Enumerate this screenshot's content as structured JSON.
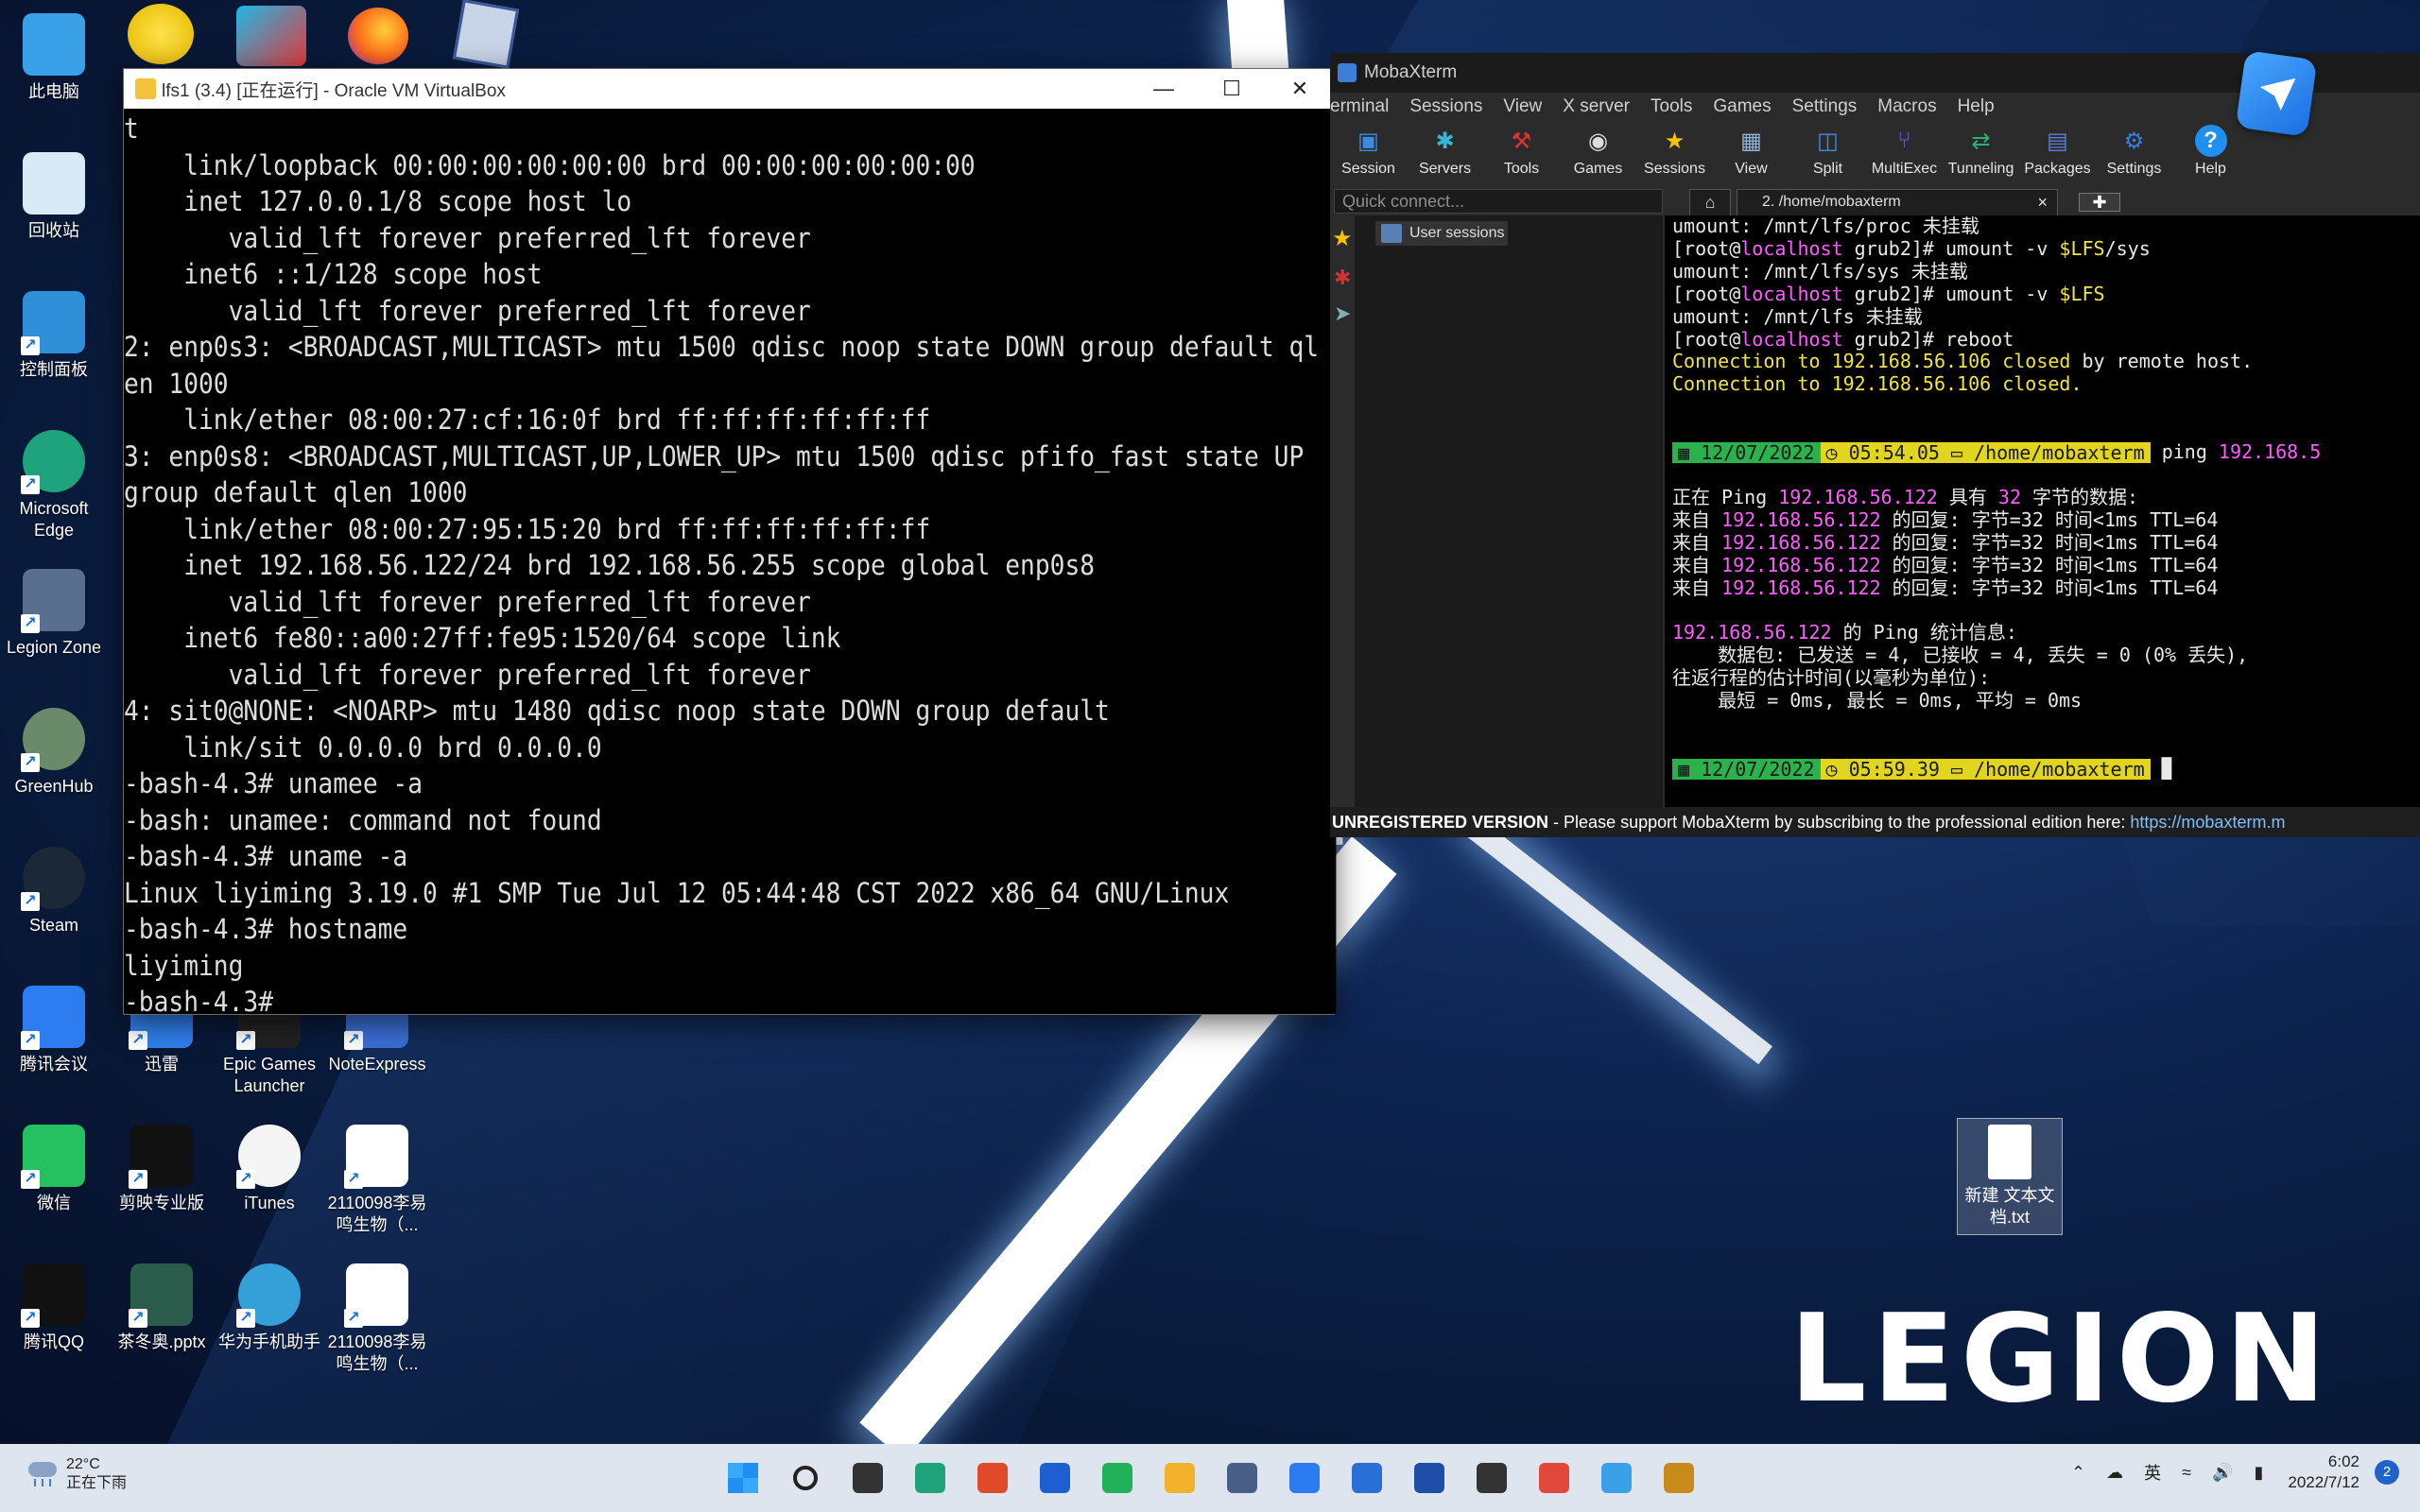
{
  "desktop": {
    "icons": [
      {
        "label": "此电脑",
        "icon": "computer-icon"
      },
      {
        "label": "回收站",
        "icon": "recycle-bin-icon"
      },
      {
        "label": "控制面板",
        "icon": "control-panel-icon"
      },
      {
        "label": "Microsoft Edge",
        "icon": "edge-icon"
      },
      {
        "label": "Legion Zone",
        "icon": "legion-zone-icon"
      },
      {
        "label": "GreenHub",
        "icon": "greenhub-icon"
      },
      {
        "label": "Steam",
        "icon": "steam-icon"
      },
      {
        "label": "腾讯会议",
        "icon": "tencent-meeting-icon"
      },
      {
        "label": "迅雷",
        "icon": "xunlei-icon"
      },
      {
        "label": "Epic Games Launcher",
        "icon": "epic-games-icon"
      },
      {
        "label": "NoteExpress",
        "icon": "noteexpress-icon"
      },
      {
        "label": "微信",
        "icon": "wechat-icon"
      },
      {
        "label": "剪映专业版",
        "icon": "jianying-icon"
      },
      {
        "label": "iTunes",
        "icon": "itunes-icon"
      },
      {
        "label": "2110098李易鸣生物（...",
        "icon": "word-doc-icon"
      },
      {
        "label": "腾讯QQ",
        "icon": "qq-icon"
      },
      {
        "label": "茶冬奥.pptx",
        "icon": "pptx-icon"
      },
      {
        "label": "华为手机助手",
        "icon": "huawei-icon"
      },
      {
        "label": "2110098李易鸣生物（...",
        "icon": "pdf-icon"
      }
    ],
    "new_file": "新建 文本文档.txt",
    "brand": "LEGION"
  },
  "virtualbox": {
    "title": "lfs1 (3.4) [正在运行] - Oracle VM VirtualBox",
    "console_lines": [
      "t",
      "    link/loopback 00:00:00:00:00:00 brd 00:00:00:00:00:00",
      "    inet 127.0.0.1/8 scope host lo",
      "       valid_lft forever preferred_lft forever",
      "    inet6 ::1/128 scope host",
      "       valid_lft forever preferred_lft forever",
      "2: enp0s3: <BROADCAST,MULTICAST> mtu 1500 qdisc noop state DOWN group default ql",
      "en 1000",
      "    link/ether 08:00:27:cf:16:0f brd ff:ff:ff:ff:ff:ff",
      "3: enp0s8: <BROADCAST,MULTICAST,UP,LOWER_UP> mtu 1500 qdisc pfifo_fast state UP",
      "group default qlen 1000",
      "    link/ether 08:00:27:95:15:20 brd ff:ff:ff:ff:ff:ff",
      "    inet 192.168.56.122/24 brd 192.168.56.255 scope global enp0s8",
      "       valid_lft forever preferred_lft forever",
      "    inet6 fe80::a00:27ff:fe95:1520/64 scope link",
      "       valid_lft forever preferred_lft forever",
      "4: sit0@NONE: <NOARP> mtu 1480 qdisc noop state DOWN group default",
      "    link/sit 0.0.0.0 brd 0.0.0.0",
      "-bash-4.3# unamee -a",
      "-bash: unamee: command not found",
      "-bash-4.3# uname -a",
      "Linux liyiming 3.19.0 #1 SMP Tue Jul 12 05:44:48 CST 2022 x86_64 GNU/Linux",
      "-bash-4.3# hostname",
      "liyiming",
      "-bash-4.3# _"
    ]
  },
  "mobaxterm": {
    "title": "MobaXterm",
    "menu": [
      "erminal",
      "Sessions",
      "View",
      "X server",
      "Tools",
      "Games",
      "Settings",
      "Macros",
      "Help"
    ],
    "toolbar": [
      {
        "label": "Session",
        "icon": "session-icon"
      },
      {
        "label": "Servers",
        "icon": "servers-icon"
      },
      {
        "label": "Tools",
        "icon": "tools-icon"
      },
      {
        "label": "Games",
        "icon": "games-icon"
      },
      {
        "label": "Sessions",
        "icon": "sessions-star-icon"
      },
      {
        "label": "View",
        "icon": "view-icon"
      },
      {
        "label": "Split",
        "icon": "split-icon"
      },
      {
        "label": "MultiExec",
        "icon": "multiexec-icon"
      },
      {
        "label": "Tunneling",
        "icon": "tunneling-icon"
      },
      {
        "label": "Packages",
        "icon": "packages-icon"
      },
      {
        "label": "Settings",
        "icon": "settings-gear-icon"
      },
      {
        "label": "Help",
        "icon": "help-icon"
      }
    ],
    "quick_connect_placeholder": "Quick connect...",
    "tab_label": "2. /home/mobaxterm",
    "user_sessions": "User sessions",
    "terminal": {
      "host": "localhost",
      "lines_top": [
        {
          "pre": "umount: /mnt/lfs/proc 未挂载",
          "host": "",
          "post": ""
        },
        {
          "pre": "[root@",
          "host": "localhost",
          "post": " grub2]# umount -v ",
          "var": "$LFS",
          "tail": "/sys"
        },
        {
          "pre": "umount: /mnt/lfs/sys 未挂载",
          "host": "",
          "post": ""
        },
        {
          "pre": "[root@",
          "host": "localhost",
          "post": " grub2]# umount -v ",
          "var": "$LFS",
          "tail": ""
        },
        {
          "pre": "umount: /mnt/lfs 未挂载",
          "host": "",
          "post": ""
        },
        {
          "pre": "[root@",
          "host": "localhost",
          "post": " grub2]# reboot",
          "var": "",
          "tail": ""
        }
      ],
      "conn1_a": "Connection to ",
      "conn1_ip": "192.168.56.106",
      "conn1_b": " closed",
      "conn1_c": " by remote host.",
      "conn2_b": " closed.",
      "prompt1": {
        "date": "12/07/2022",
        "time": "05:54.05",
        "dir": "/home/mobaxterm",
        "cmd": " ping ",
        "arg": "192.168.5"
      },
      "ping_head_a": "正在 Ping ",
      "ping_ip": "192.168.56.122",
      "ping_head_b": " 具有 ",
      "ping_bytes": "32",
      "ping_head_c": " 字节的数据:",
      "reply_pre": "来自 ",
      "reply_post": " 的回复: 字节=32 时间<1ms TTL=64",
      "reply_count": 4,
      "stats_a": " 的 Ping 统计信息:",
      "stats_1": "    数据包: 已发送 = 4, 已接收 = 4, 丢失 = 0 (0% 丢失),",
      "stats_2": "往返行程的估计时间(以毫秒为单位):",
      "stats_3": "    最短 = 0ms, 最长 = 0ms, 平均 = 0ms",
      "prompt2": {
        "date": "12/07/2022",
        "time": "05:59.39",
        "dir": "/home/mobaxterm"
      }
    },
    "unregistered_bold": "UNREGISTERED VERSION",
    "unregistered_text": "  -  Please support MobaXterm by subscribing to the professional edition here:  ",
    "unregistered_link": "https://mobaxterm.m"
  },
  "taskbar": {
    "weather_temp": "22°C",
    "weather_text": "正在下雨",
    "apps": [
      "windows-start-icon",
      "search-icon",
      "task-view-icon",
      "edge-taskbar-icon",
      "store-icon",
      "lenovo-vantage-icon",
      "wechat-pay-icon",
      "file-explorer-icon",
      "virtualbox-taskbar-icon",
      "feishu-icon",
      "wps-writer-icon",
      "word-icon",
      "mobaxterm-taskbar-icon",
      "git-icon",
      "notepad-icon",
      "game-app-icon"
    ],
    "ime": "英",
    "time": "6:02",
    "date": "2022/7/12",
    "notifications": "2"
  }
}
